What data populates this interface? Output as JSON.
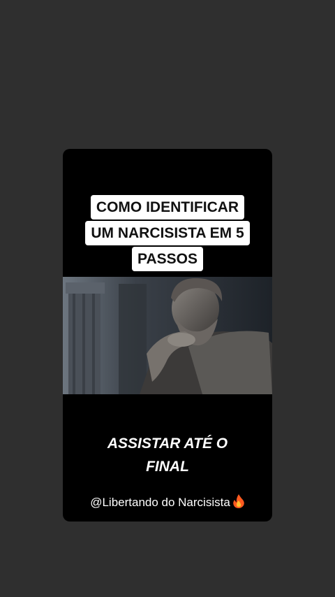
{
  "story": {
    "title_lines": [
      "COMO IDENTIFICAR",
      "UM NARCISISTA EM 5",
      "PASSOS"
    ],
    "cta_lines": [
      "ASSISTAR ATÉ O",
      "FINAL"
    ],
    "handle": "@Libertando do Narcisista",
    "handle_icon": "fire-icon",
    "image_icon": "statue-thinker-image"
  },
  "colors": {
    "backdrop": "#2f2f2f",
    "card": "#000000",
    "title_bg": "#ffffff",
    "text": "#ffffff"
  }
}
